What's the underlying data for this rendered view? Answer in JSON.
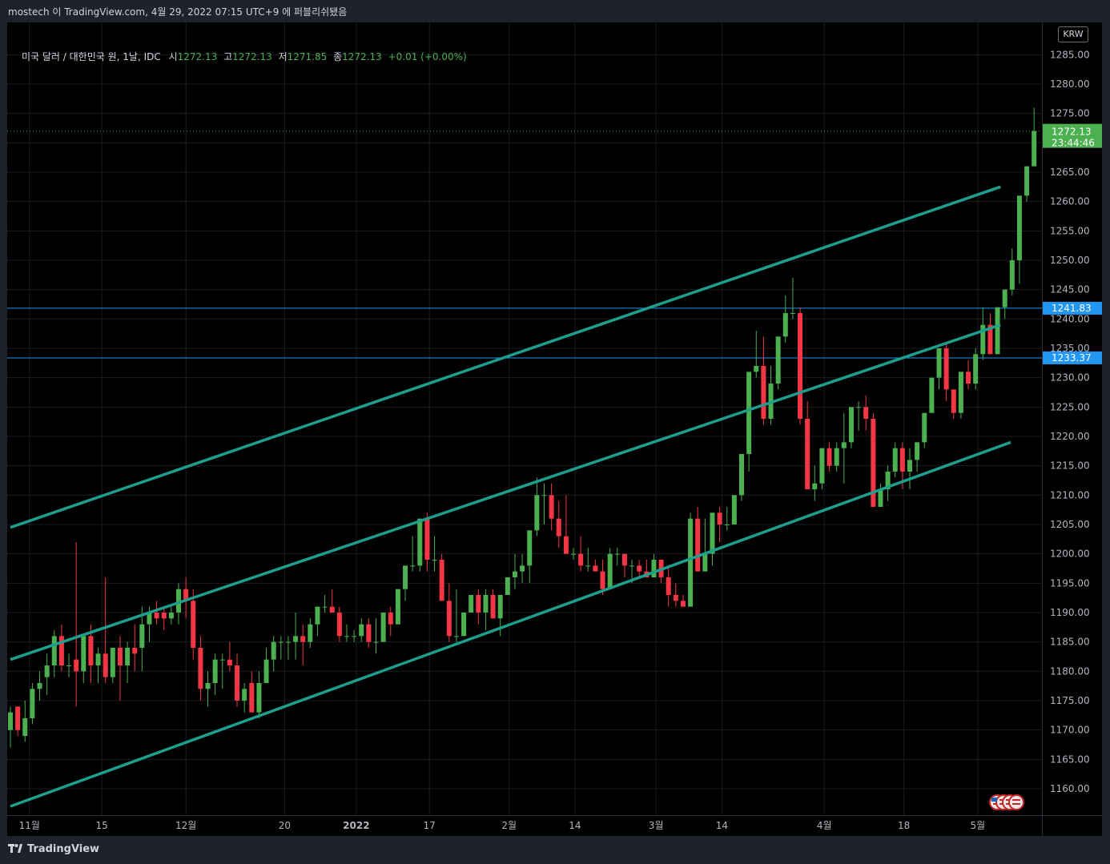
{
  "caption": "mostech 이 TradingView.com, 4월 29, 2022 07:15 UTC+9 에 퍼블리쉬됐음",
  "legend": {
    "symbol": "미국 달러 / 대한민국 원, 1날, IDC",
    "open_label": "시",
    "open": "1272.13",
    "high_label": "고",
    "high": "1272.13",
    "low_label": "저",
    "low": "1271.85",
    "close_label": "종",
    "close": "1272.13",
    "change": "+0.01 (+0.00%)"
  },
  "currency": "KRW",
  "price_tag": {
    "value": "1272.13",
    "countdown": "23:44:46",
    "color": "#4caf50"
  },
  "hlines": [
    {
      "value": 1241.83,
      "label": "1241.83",
      "color": "#2196f3"
    },
    {
      "value": 1233.37,
      "label": "1233.37",
      "color": "#2196f3"
    }
  ],
  "footer": {
    "brand": "TradingView",
    "logo_icon": "tradingview-logo-icon"
  },
  "flag_icon": "us-flag-icon",
  "colors": {
    "up": "#4caf50",
    "down": "#f23645",
    "channel": "#1e9e8c",
    "grid": "#1a1d26",
    "axis_text": "#b2b5be"
  },
  "chart_data": {
    "type": "candlestick",
    "ylim": [
      1155.5,
      1290.5
    ],
    "y_ticks": [
      1160,
      1165,
      1170,
      1175,
      1180,
      1185,
      1190,
      1195,
      1200,
      1205,
      1210,
      1215,
      1220,
      1225,
      1230,
      1235,
      1240,
      1245,
      1250,
      1255,
      1260,
      1265,
      1270,
      1275,
      1280,
      1285
    ],
    "x_ticks": [
      {
        "label": "11월",
        "index": 2.6,
        "bold": false
      },
      {
        "label": "15",
        "index": 12.5,
        "bold": false
      },
      {
        "label": "12월",
        "index": 24,
        "bold": false
      },
      {
        "label": "20",
        "index": 37.5,
        "bold": false
      },
      {
        "label": "2022",
        "index": 47.3,
        "bold": true
      },
      {
        "label": "17",
        "index": 57.3,
        "bold": false
      },
      {
        "label": "2월",
        "index": 68.2,
        "bold": false
      },
      {
        "label": "14",
        "index": 77.2,
        "bold": false
      },
      {
        "label": "3월",
        "index": 88.3,
        "bold": false
      },
      {
        "label": "14",
        "index": 97.3,
        "bold": false
      },
      {
        "label": "4월",
        "index": 111.3,
        "bold": false
      },
      {
        "label": "18",
        "index": 122.2,
        "bold": false
      },
      {
        "label": "5월",
        "index": 132.3,
        "bold": false
      }
    ],
    "candles": [
      [
        1170,
        1174,
        1167,
        1173
      ],
      [
        1174,
        1174,
        1169,
        1170
      ],
      [
        1169,
        1175,
        1168,
        1172
      ],
      [
        1172,
        1178,
        1171,
        1177
      ],
      [
        1177,
        1180,
        1175,
        1178
      ],
      [
        1179,
        1183,
        1176,
        1181
      ],
      [
        1181,
        1187,
        1179,
        1186
      ],
      [
        1186,
        1188,
        1180,
        1181
      ],
      [
        1181,
        1183,
        1179,
        1181
      ],
      [
        1182,
        1202,
        1174,
        1180
      ],
      [
        1180,
        1186,
        1178,
        1186
      ],
      [
        1186,
        1188,
        1178,
        1181
      ],
      [
        1181,
        1184,
        1178,
        1183
      ],
      [
        1183,
        1196,
        1178,
        1179
      ],
      [
        1179,
        1184,
        1178,
        1184
      ],
      [
        1184,
        1186,
        1175,
        1181
      ],
      [
        1181,
        1185,
        1178,
        1184
      ],
      [
        1184,
        1188,
        1180,
        1183
      ],
      [
        1184,
        1191,
        1180,
        1188
      ],
      [
        1188,
        1191,
        1185,
        1190
      ],
      [
        1190,
        1192,
        1188,
        1189
      ],
      [
        1190,
        1191,
        1187,
        1189
      ],
      [
        1189,
        1191,
        1188,
        1190
      ],
      [
        1190,
        1195,
        1188,
        1194
      ],
      [
        1194,
        1196,
        1189,
        1192
      ],
      [
        1192,
        1194,
        1182,
        1184
      ],
      [
        1184,
        1186,
        1175,
        1177
      ],
      [
        1177,
        1180,
        1174,
        1178
      ],
      [
        1178,
        1183,
        1176,
        1182
      ],
      [
        1182,
        1183,
        1177,
        1182
      ],
      [
        1182,
        1185,
        1180,
        1181
      ],
      [
        1181,
        1183,
        1174,
        1175
      ],
      [
        1175,
        1178,
        1173,
        1177
      ],
      [
        1178,
        1180,
        1173,
        1173
      ],
      [
        1173,
        1180,
        1172,
        1178
      ],
      [
        1178,
        1184,
        1178,
        1182
      ],
      [
        1182,
        1186,
        1180,
        1185
      ],
      [
        1185,
        1186,
        1182,
        1185
      ],
      [
        1185,
        1186,
        1182,
        1185
      ],
      [
        1185,
        1190,
        1182,
        1186
      ],
      [
        1186,
        1188,
        1181,
        1185
      ],
      [
        1185,
        1189,
        1184,
        1188
      ],
      [
        1188,
        1191,
        1186,
        1191
      ],
      [
        1191,
        1193,
        1190,
        1191
      ],
      [
        1191,
        1194,
        1190,
        1190
      ],
      [
        1190,
        1191,
        1185,
        1186
      ],
      [
        1186,
        1188,
        1185,
        1186
      ],
      [
        1186,
        1187,
        1185,
        1186
      ],
      [
        1186,
        1189,
        1185,
        1188
      ],
      [
        1188,
        1189,
        1184,
        1185
      ],
      [
        1185,
        1189,
        1183,
        1185
      ],
      [
        1185,
        1190,
        1185,
        1190
      ],
      [
        1190,
        1191,
        1186,
        1188
      ],
      [
        1188,
        1194,
        1188,
        1194
      ],
      [
        1194,
        1198,
        1192,
        1198
      ],
      [
        1198,
        1203,
        1197,
        1198
      ],
      [
        1198,
        1205,
        1197,
        1206
      ],
      [
        1206,
        1207,
        1197,
        1199
      ],
      [
        1199,
        1203,
        1197,
        1199
      ],
      [
        1199,
        1200,
        1192,
        1192
      ],
      [
        1192,
        1195,
        1185,
        1186
      ],
      [
        1186,
        1194,
        1185,
        1186
      ],
      [
        1186,
        1190,
        1186,
        1190
      ],
      [
        1190,
        1193,
        1190,
        1193
      ],
      [
        1193,
        1194,
        1188,
        1190
      ],
      [
        1190,
        1194,
        1187,
        1193
      ],
      [
        1193,
        1194,
        1189,
        1189
      ],
      [
        1189,
        1190,
        1186,
        1193
      ],
      [
        1193,
        1196,
        1193,
        1196
      ],
      [
        1196,
        1200,
        1194,
        1197
      ],
      [
        1197,
        1200,
        1195,
        1198
      ],
      [
        1198,
        1200,
        1195,
        1204
      ],
      [
        1204,
        1213,
        1203,
        1210
      ],
      [
        1210,
        1212,
        1205,
        1210
      ],
      [
        1210,
        1212,
        1204,
        1206
      ],
      [
        1206,
        1209,
        1201,
        1203
      ],
      [
        1203,
        1210,
        1200,
        1200
      ],
      [
        1200,
        1201,
        1199,
        1200
      ],
      [
        1200,
        1203,
        1197,
        1198
      ],
      [
        1198,
        1201,
        1197,
        1198
      ],
      [
        1198,
        1199,
        1197,
        1197
      ],
      [
        1197,
        1199,
        1193,
        1194
      ],
      [
        1194,
        1201,
        1194,
        1200
      ],
      [
        1200,
        1201,
        1198,
        1200
      ],
      [
        1200,
        1200,
        1196,
        1198
      ],
      [
        1198,
        1199,
        1195,
        1198
      ],
      [
        1198,
        1199,
        1196,
        1197
      ],
      [
        1197,
        1199,
        1196,
        1196
      ],
      [
        1196,
        1200,
        1196,
        1199
      ],
      [
        1199,
        1199,
        1195,
        1196
      ],
      [
        1196,
        1198,
        1191,
        1193
      ],
      [
        1193,
        1195,
        1191,
        1192
      ],
      [
        1192,
        1193,
        1191,
        1191
      ],
      [
        1191,
        1207,
        1191,
        1206
      ],
      [
        1206,
        1208,
        1197,
        1197
      ],
      [
        1197,
        1206,
        1197,
        1200
      ],
      [
        1200,
        1207,
        1198,
        1207
      ],
      [
        1207,
        1208,
        1202,
        1205
      ],
      [
        1205,
        1208,
        1204,
        1205
      ],
      [
        1205,
        1209,
        1205,
        1210
      ],
      [
        1210,
        1217,
        1209,
        1217
      ],
      [
        1217,
        1220,
        1214,
        1231
      ],
      [
        1231,
        1238,
        1230,
        1232
      ],
      [
        1232,
        1237,
        1222,
        1223
      ],
      [
        1223,
        1232,
        1222,
        1229
      ],
      [
        1229,
        1237,
        1228,
        1237
      ],
      [
        1237,
        1244,
        1236,
        1241
      ],
      [
        1241,
        1247,
        1240,
        1241
      ],
      [
        1241,
        1242,
        1222,
        1223
      ],
      [
        1223,
        1226,
        1211,
        1211
      ],
      [
        1211,
        1215,
        1209,
        1212
      ],
      [
        1212,
        1218,
        1211,
        1218
      ],
      [
        1218,
        1219,
        1214,
        1215
      ],
      [
        1215,
        1219,
        1214,
        1218
      ],
      [
        1218,
        1224,
        1212,
        1219
      ],
      [
        1219,
        1224,
        1218,
        1225
      ],
      [
        1225,
        1226,
        1221,
        1225
      ],
      [
        1225,
        1227,
        1221,
        1223
      ],
      [
        1223,
        1224,
        1208,
        1208
      ],
      [
        1208,
        1212,
        1208,
        1211
      ],
      [
        1211,
        1215,
        1209,
        1214
      ],
      [
        1214,
        1219,
        1213,
        1218
      ],
      [
        1218,
        1219,
        1211,
        1214
      ],
      [
        1214,
        1218,
        1211,
        1216
      ],
      [
        1216,
        1219,
        1214,
        1219
      ],
      [
        1219,
        1222,
        1218,
        1224
      ],
      [
        1224,
        1230,
        1224,
        1230
      ],
      [
        1230,
        1235,
        1228,
        1235
      ],
      [
        1235,
        1236,
        1226,
        1228
      ],
      [
        1228,
        1228,
        1223,
        1224
      ],
      [
        1224,
        1230,
        1223,
        1231
      ],
      [
        1231,
        1233,
        1228,
        1229
      ],
      [
        1229,
        1235,
        1228,
        1234
      ],
      [
        1234,
        1242,
        1233,
        1239
      ],
      [
        1239,
        1241,
        1234,
        1234
      ],
      [
        1234,
        1241,
        1234,
        1242
      ],
      [
        1242,
        1245,
        1240,
        1245
      ],
      [
        1245,
        1252,
        1244,
        1250
      ],
      [
        1250,
        1256,
        1246,
        1261
      ],
      [
        1261,
        1266,
        1260,
        1266
      ],
      [
        1266,
        1276,
        1266,
        1272
      ]
    ],
    "channel_lines": [
      {
        "x0": 0,
        "y0": 1204.5,
        "x1": 135.4,
        "y1": 1262.5
      },
      {
        "x0": 0,
        "y0": 1182.0,
        "x1": 135.4,
        "y1": 1239.0
      },
      {
        "x0": 0,
        "y0": 1157.0,
        "x1": 136.8,
        "y1": 1219.0
      }
    ]
  }
}
